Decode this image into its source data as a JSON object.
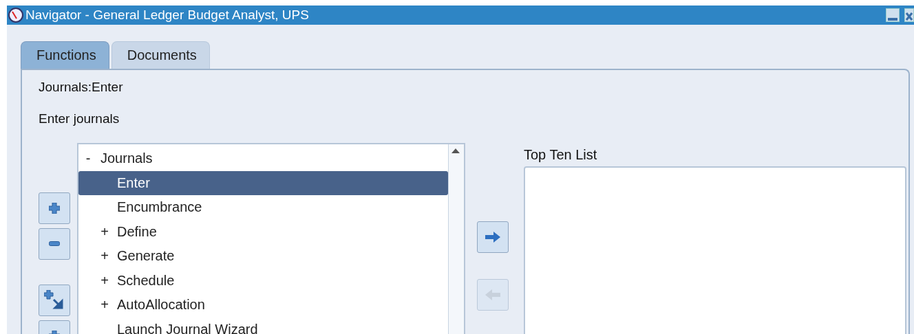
{
  "window": {
    "title": "Navigator - General Ledger Budget Analyst, UPS"
  },
  "tabs": [
    {
      "label": "Functions",
      "selected": true
    },
    {
      "label": "Documents",
      "selected": false
    }
  ],
  "function_name": "Journals:Enter",
  "function_description": "Enter journals",
  "tree": [
    {
      "label": "Journals",
      "marker": "-",
      "selected": false,
      "children": [
        {
          "label": "Enter",
          "selected": true
        },
        {
          "label": "Encumbrance",
          "selected": false
        },
        {
          "label": "Define",
          "marker": "+",
          "selected": false
        },
        {
          "label": "Generate",
          "marker": "+",
          "selected": false
        },
        {
          "label": "Schedule",
          "marker": "+",
          "selected": false
        },
        {
          "label": "AutoAllocation",
          "marker": "+",
          "selected": false
        },
        {
          "label": "Launch Journal Wizard",
          "selected": false
        }
      ]
    }
  ],
  "add_button": {
    "disabled": false
  },
  "remove_button": {
    "disabled": true
  },
  "top_ten": {
    "label": "Top Ten List"
  }
}
